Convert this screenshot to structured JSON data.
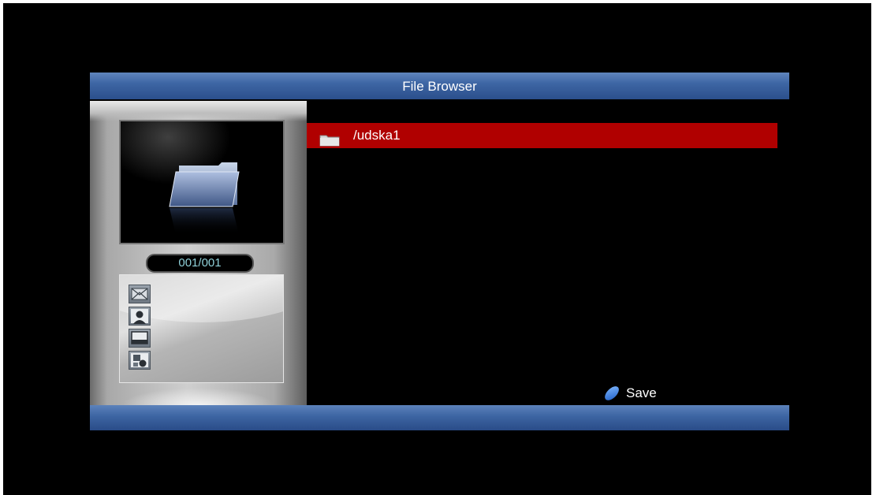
{
  "window": {
    "title": "File Browser"
  },
  "preview": {
    "counter": "001/001",
    "icon": "folder-icon"
  },
  "media_types": [
    {
      "icon": "photo-icon"
    },
    {
      "icon": "person-icon"
    },
    {
      "icon": "video-icon"
    },
    {
      "icon": "shapes-icon"
    }
  ],
  "file_list": {
    "items": [
      {
        "name": "/udska1",
        "type": "folder",
        "selected": true
      }
    ]
  },
  "hints": {
    "save": {
      "color": "blue",
      "label": "Save"
    }
  },
  "colors": {
    "title_bar": "#3e66a4",
    "selected_row": "#b00000",
    "counter_text": "#8fd0d8",
    "background": "#000000"
  }
}
